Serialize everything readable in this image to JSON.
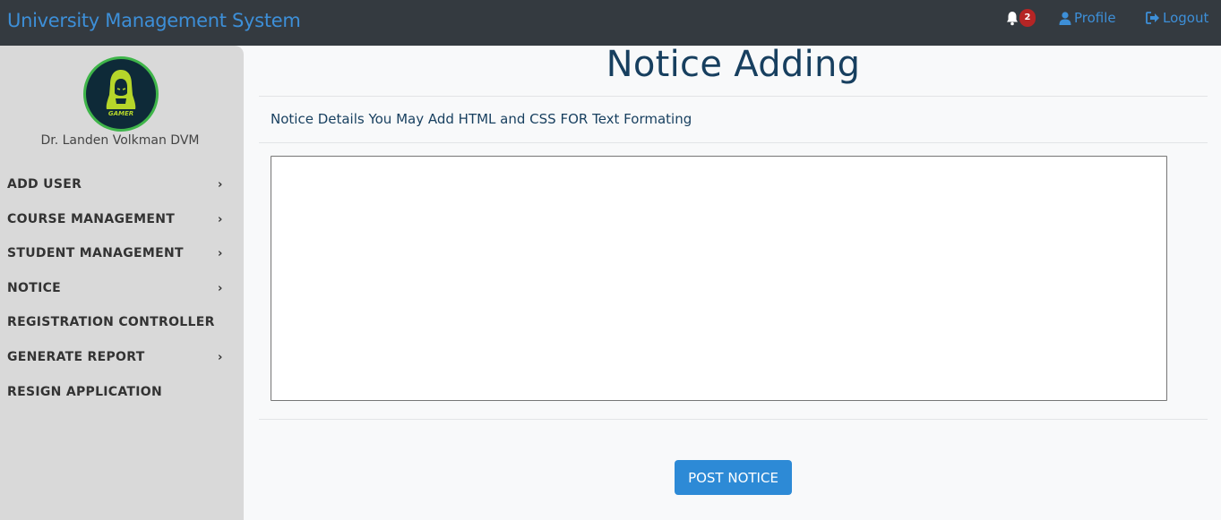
{
  "header": {
    "brand": "University Management System",
    "notifications_count": "2",
    "profile_label": "Profile",
    "logout_label": "Logout",
    "bell_icon": "bell-icon",
    "profile_icon": "user-icon",
    "logout_icon": "sign-out-icon"
  },
  "sidebar": {
    "avatar_text": "GAMER",
    "user_name": "Dr. Landen Volkman DVM",
    "items": [
      {
        "label": "ADD USER",
        "chevron": "›"
      },
      {
        "label": "COURSE MANAGEMENT",
        "chevron": "›"
      },
      {
        "label": "STUDENT MANAGEMENT",
        "chevron": "›"
      },
      {
        "label": "NOTICE",
        "chevron": "›"
      },
      {
        "label": "REGISTRATION CONTROLLER"
      },
      {
        "label": "GENERATE REPORT",
        "chevron": "›"
      },
      {
        "label": "RESIGN APPLICATION"
      }
    ]
  },
  "main": {
    "title": "Notice Adding",
    "details_label": "Notice Details You May Add HTML and CSS FOR Text Formating",
    "notice_text": "",
    "post_button": "POST NOTICE"
  },
  "colors": {
    "navbar_bg": "#343a40",
    "brand": "#3d8fd8",
    "sidebar_bg": "#d9d9d9",
    "title": "#173f5f",
    "button": "#2d8ad6",
    "badge": "#b52525",
    "avatar_ring": "#3fb54a"
  }
}
